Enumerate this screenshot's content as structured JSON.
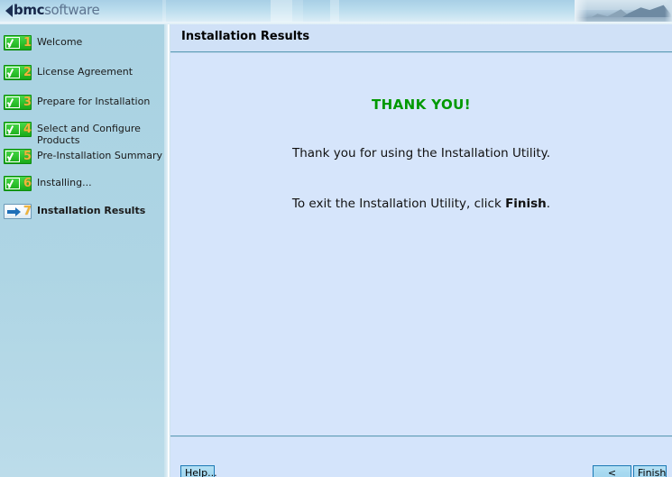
{
  "header": {
    "logo_chevron_icon": "chevron-left-icon",
    "logo_bmc": "bmc",
    "logo_software": "software",
    "banner_photo_icon": "mountain-landscape-image"
  },
  "sidebar": {
    "steps": [
      {
        "number": "1",
        "label": "Welcome",
        "state": "done",
        "icon": "green-check-icon"
      },
      {
        "number": "2",
        "label": "License Agreement",
        "state": "done",
        "icon": "green-check-icon"
      },
      {
        "number": "3",
        "label": "Prepare for Installation",
        "state": "done",
        "icon": "green-check-icon"
      },
      {
        "number": "4",
        "label": "Select and Configure Products",
        "state": "done",
        "icon": "green-check-icon"
      },
      {
        "number": "5",
        "label": "Pre-Installation Summary",
        "state": "done",
        "icon": "green-check-icon"
      },
      {
        "number": "6",
        "label": "Installing...",
        "state": "done",
        "icon": "green-check-icon"
      },
      {
        "number": "7",
        "label": "Installation Results",
        "state": "current",
        "icon": "blue-arrow-icon"
      }
    ]
  },
  "main": {
    "title": "Installation Results",
    "heading": "THANK YOU!",
    "line1": "Thank you for using the Installation Utility.",
    "line2_before": "To exit the Installation Utility, click ",
    "line2_bold": "Finish",
    "line2_after": "."
  },
  "footer": {
    "help_label": "Help...",
    "back_label": "< Back",
    "finish_label": "Finish"
  },
  "colors": {
    "accent_green": "#009900",
    "banner_blue": "#a8cfe6",
    "sidebar_blue": "#a9d2e2",
    "content_blue": "#d6e5fb",
    "button_border": "#1b79b5",
    "step_number": "#f0b43a"
  }
}
